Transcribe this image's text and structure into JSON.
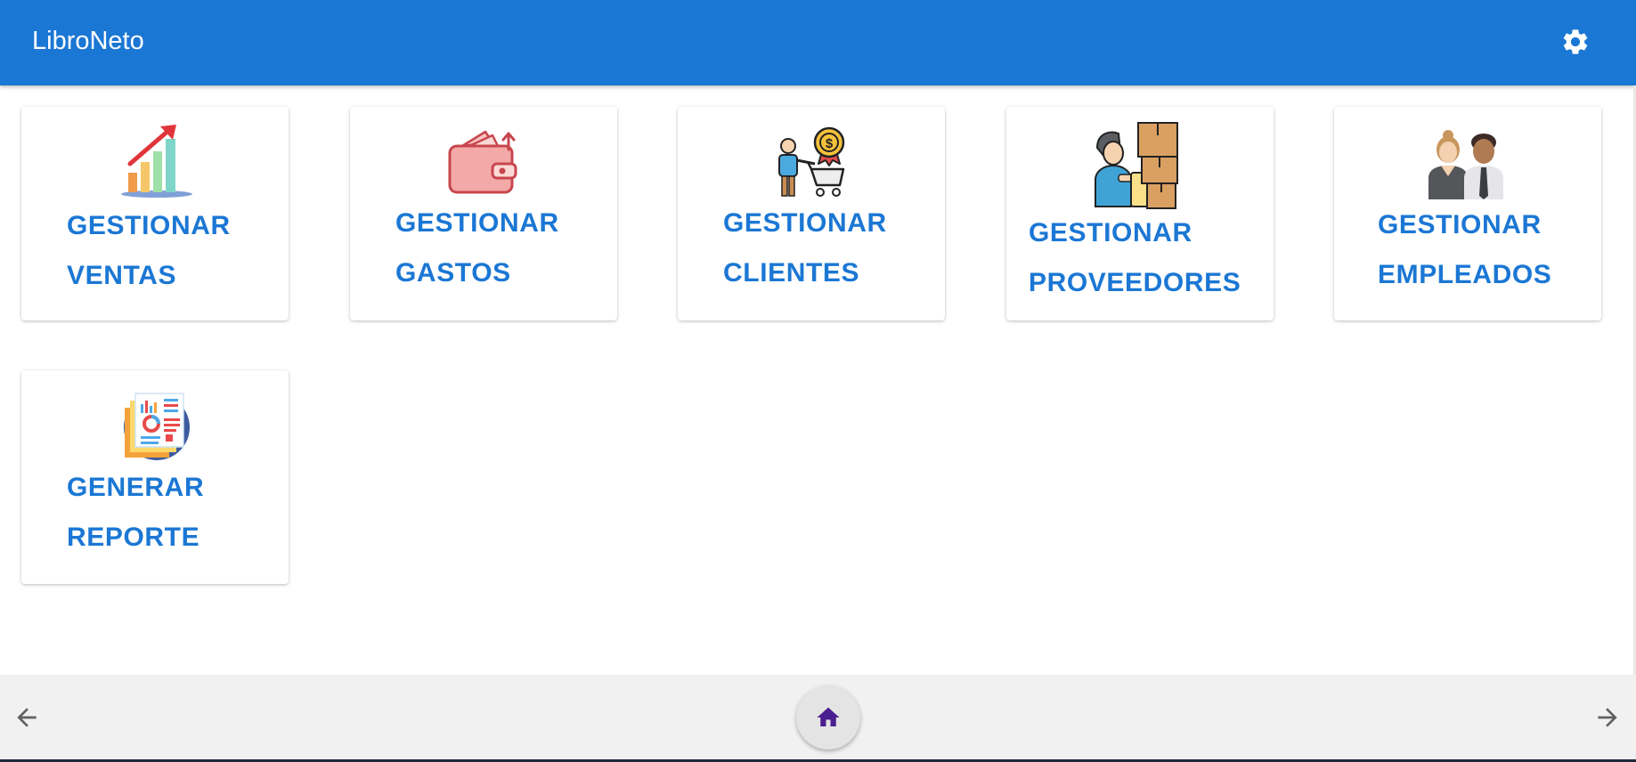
{
  "appbar": {
    "title": "LibroNeto",
    "settings_icon": "gear-icon",
    "background": "#1b77d4"
  },
  "cards": [
    {
      "id": "ventas",
      "line1": "GESTIONAR",
      "line2": "VENTAS",
      "icon": "sales-growth-chart-icon"
    },
    {
      "id": "gastos",
      "line1": "GESTIONAR",
      "line2": "GASTOS",
      "icon": "wallet-expense-icon"
    },
    {
      "id": "clientes",
      "line1": "GESTIONAR",
      "line2": "CLIENTES",
      "icon": "customer-cart-icon"
    },
    {
      "id": "proveedores",
      "line1": "GESTIONAR",
      "line2": "PROVEEDORES",
      "icon": "supplier-boxes-icon"
    },
    {
      "id": "empleados",
      "line1": "GESTIONAR",
      "line2": "EMPLEADOS",
      "icon": "employees-icon"
    },
    {
      "id": "reporte",
      "line1": "GENERAR",
      "line2": "REPORTE",
      "icon": "report-document-icon"
    }
  ],
  "bottom_nav": {
    "back_icon": "arrow-left-icon",
    "home_icon": "home-icon",
    "forward_icon": "arrow-right-icon",
    "home_icon_color": "#4a1f8f"
  },
  "colors": {
    "accent": "#1b77d4",
    "card_background": "#ffffff",
    "bottom_bar": "#f1f1f1"
  }
}
